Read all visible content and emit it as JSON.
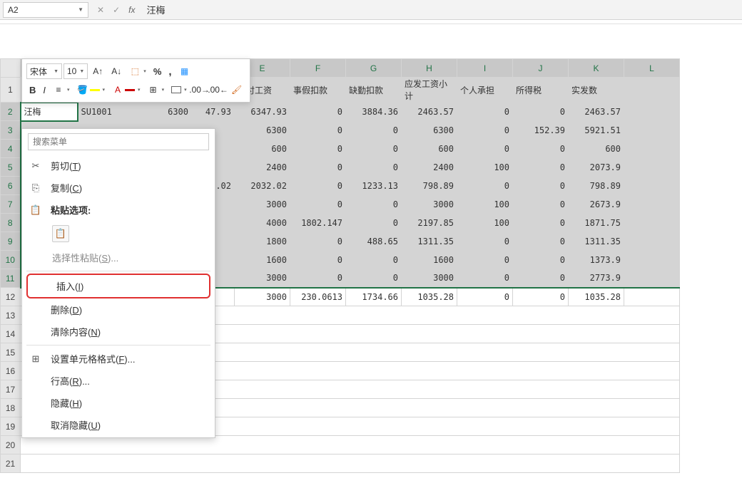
{
  "namebox": {
    "value": "A2"
  },
  "formula": {
    "value": "汪梅"
  },
  "minitoolbar": {
    "font": "宋体",
    "size": "10"
  },
  "columns": [
    "",
    "",
    "",
    "",
    "E",
    "F",
    "G",
    "H",
    "I",
    "J",
    "K",
    "L"
  ],
  "headers": {
    "E": "应付工资",
    "F": "事假扣款",
    "G": "缺勤扣款",
    "H": "应发工资小计",
    "I": "个人承担",
    "J": "所得税",
    "K": "实发数"
  },
  "row1_visible": {
    "A": "汪梅",
    "B": "SU1001",
    "C_num": "6300"
  },
  "chart_data": {
    "type": "table",
    "rows": [
      {
        "D": "47.93",
        "E": "6347.93",
        "F": "0",
        "G": "3884.36",
        "H": "2463.57",
        "I": "0",
        "J": "0",
        "K": "2463.57"
      },
      {
        "D": "",
        "E": "6300",
        "F": "0",
        "G": "0",
        "H": "6300",
        "I": "0",
        "J": "152.39",
        "K": "5921.51"
      },
      {
        "D": "",
        "E": "600",
        "F": "0",
        "G": "0",
        "H": "600",
        "I": "0",
        "J": "0",
        "K": "600"
      },
      {
        "D": "",
        "E": "2400",
        "F": "0",
        "G": "0",
        "H": "2400",
        "I": "100",
        "J": "0",
        "K": "2073.9"
      },
      {
        "D": "32.02",
        "E": "2032.02",
        "F": "0",
        "G": "1233.13",
        "H": "798.89",
        "I": "0",
        "J": "0",
        "K": "798.89"
      },
      {
        "D": "",
        "E": "3000",
        "F": "0",
        "G": "0",
        "H": "3000",
        "I": "100",
        "J": "0",
        "K": "2673.9"
      },
      {
        "D": "",
        "E": "4000",
        "F": "1802.147",
        "G": "0",
        "H": "2197.85",
        "I": "100",
        "J": "0",
        "K": "1871.75"
      },
      {
        "D": "",
        "E": "1800",
        "F": "0",
        "G": "488.65",
        "H": "1311.35",
        "I": "0",
        "J": "0",
        "K": "1311.35"
      },
      {
        "D": "",
        "E": "1600",
        "F": "0",
        "G": "0",
        "H": "1600",
        "I": "0",
        "J": "0",
        "K": "1373.9"
      },
      {
        "D": "",
        "E": "3000",
        "F": "0",
        "G": "0",
        "H": "3000",
        "I": "0",
        "J": "0",
        "K": "2773.9"
      },
      {
        "D": "",
        "E": "3000",
        "F": "230.0613",
        "G": "1734.66",
        "H": "1035.28",
        "I": "0",
        "J": "0",
        "K": "1035.28"
      }
    ]
  },
  "context_menu": {
    "search_placeholder": "搜索菜单",
    "cut": "剪切(T)",
    "copy": "复制(C)",
    "paste_options": "粘贴选项:",
    "paste_special": "选择性粘贴(S)...",
    "insert": "插入(I)",
    "delete": "删除(D)",
    "clear": "清除内容(N)",
    "format_cells": "设置单元格格式(F)...",
    "row_height": "行高(R)...",
    "hide": "隐藏(H)",
    "unhide": "取消隐藏(U)"
  }
}
